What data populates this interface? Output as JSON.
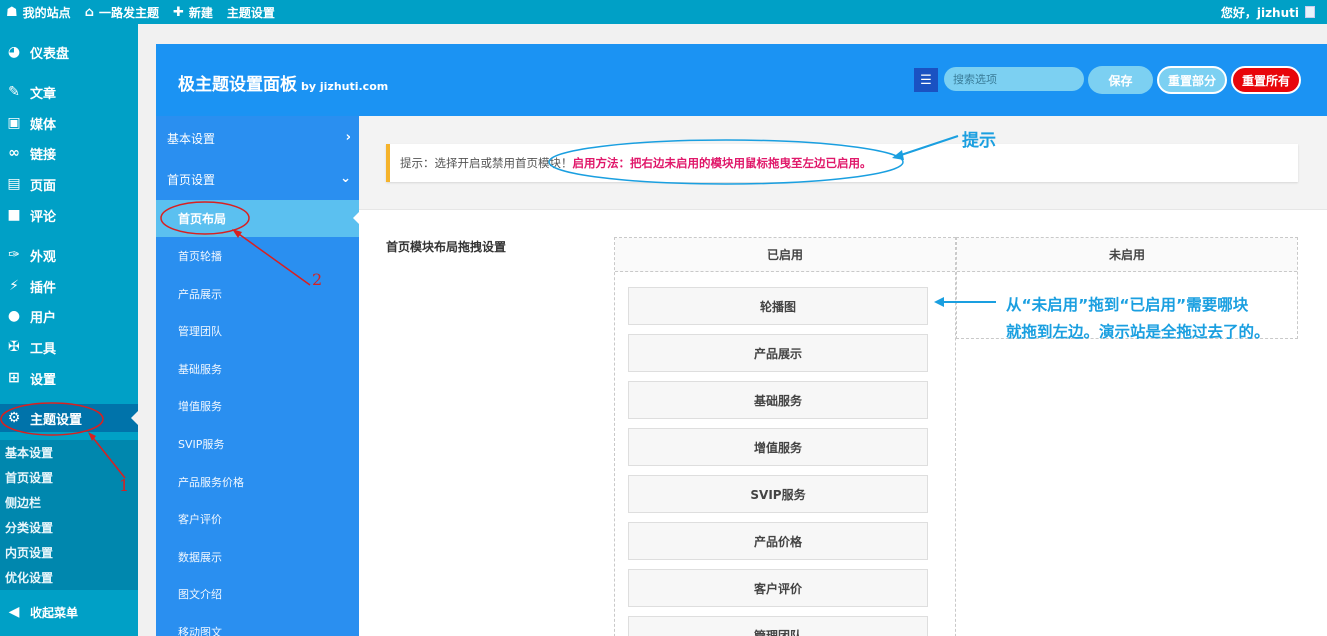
{
  "adminbar": {
    "site": "我的站点",
    "theme_site": "一路发主题",
    "new": "新建",
    "theme_settings": "主题设置",
    "greeting": "您好，jizhuti"
  },
  "sidebar": {
    "items": [
      {
        "label": "仪表盘",
        "icon": "dashboard-icon"
      },
      {
        "label": "文章",
        "icon": "pin-icon"
      },
      {
        "label": "媒体",
        "icon": "media-icon"
      },
      {
        "label": "链接",
        "icon": "link-icon"
      },
      {
        "label": "页面",
        "icon": "page-icon"
      },
      {
        "label": "评论",
        "icon": "comment-icon"
      },
      {
        "label": "外观",
        "icon": "brush-icon"
      },
      {
        "label": "插件",
        "icon": "plugin-icon"
      },
      {
        "label": "用户",
        "icon": "user-icon"
      },
      {
        "label": "工具",
        "icon": "wrench-icon"
      },
      {
        "label": "设置",
        "icon": "settings-icon"
      },
      {
        "label": "主题设置",
        "icon": "gear-icon"
      }
    ],
    "submenu": [
      "基本设置",
      "首页设置",
      "侧边栏",
      "分类设置",
      "内页设置",
      "优化设置"
    ],
    "collapse": "收起菜单"
  },
  "panel": {
    "title": "极主题设置面板",
    "by": "by jizhuti.com",
    "search_placeholder": "搜索选项",
    "save": "保存",
    "reset_part": "重置部分",
    "reset_all": "重置所有"
  },
  "nav": {
    "groups": [
      "基本设置",
      "首页设置"
    ],
    "subs": [
      "首页布局",
      "首页轮播",
      "产品展示",
      "管理团队",
      "基础服务",
      "增值服务",
      "SVIP服务",
      "产品服务价格",
      "客户评价",
      "数据展示",
      "图文介绍",
      "移动图文"
    ]
  },
  "notice": {
    "prefix": "提示：选择开启或禁用首页模块！",
    "method": "启用方法：把右边未启用的模块用鼠标拖曳至左边已启用。"
  },
  "layout_section": {
    "label": "首页模块布局拖拽设置",
    "enabled_title": "已启用",
    "disabled_title": "未启用",
    "modules": [
      "轮播图",
      "产品展示",
      "基础服务",
      "增值服务",
      "SVIP服务",
      "产品价格",
      "客户评价",
      "管理团队"
    ]
  },
  "annotations": {
    "hint": "提示",
    "drag_line1": "从“未启用”拖到“已启用”需要哪块",
    "drag_line2": "就拖到左边。演示站是全拖过去了的。",
    "num1": "1",
    "num2": "2",
    "color": "#1a9fe0",
    "red": "#d92020"
  }
}
